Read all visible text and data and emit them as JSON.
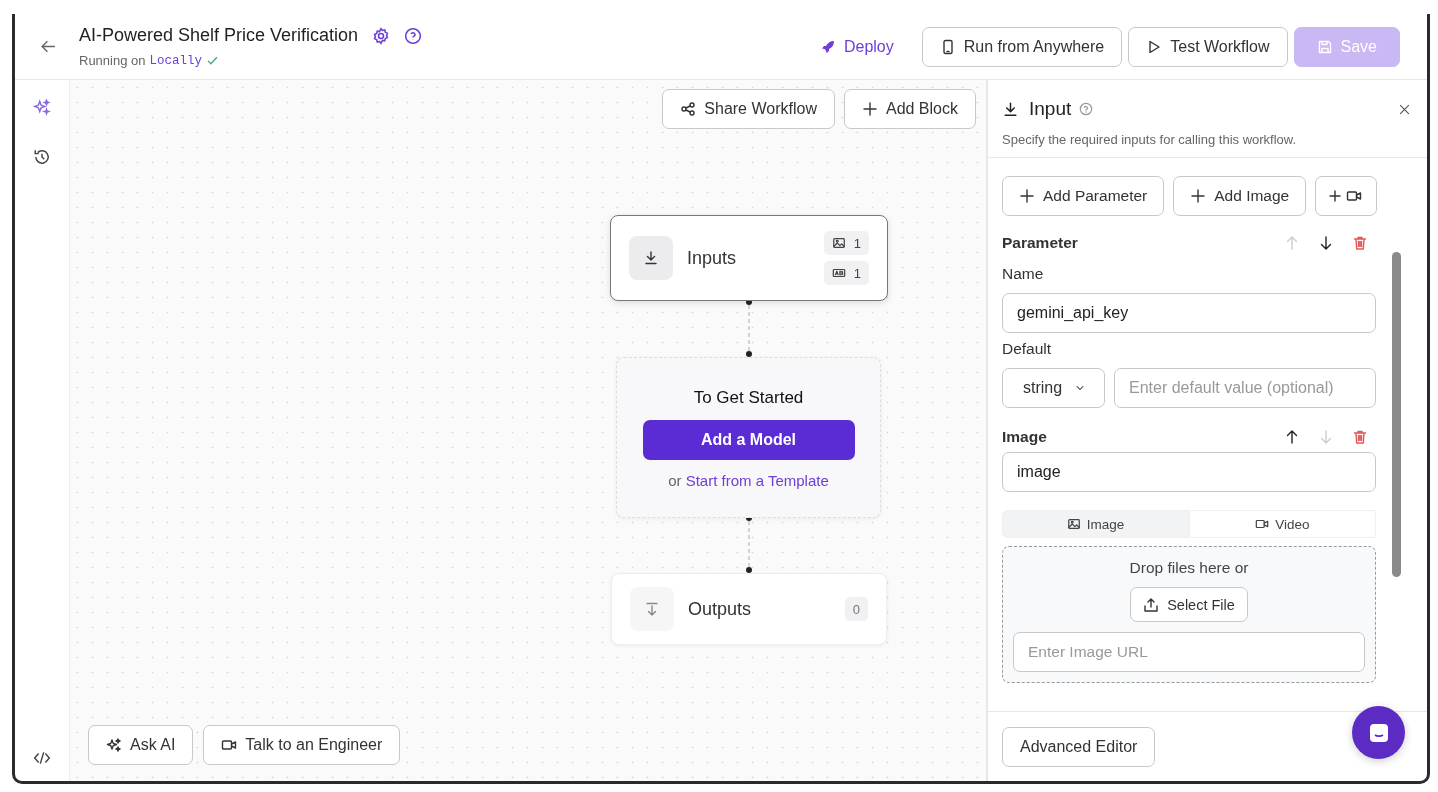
{
  "header": {
    "title": "AI-Powered Shelf Price Verification",
    "running_label": "Running on",
    "runtime": "Locally",
    "deploy": "Deploy",
    "buttons": [
      {
        "label": "Run from Anywhere",
        "kind": "phone",
        "disabled": false
      },
      {
        "label": "Test Workflow",
        "kind": "play",
        "disabled": false
      },
      {
        "label": "Save",
        "kind": "save",
        "disabled": true
      }
    ]
  },
  "canvas": {
    "toolbar": [
      {
        "label": "Share Workflow",
        "kind": "share"
      },
      {
        "label": "Add Block",
        "kind": "plus"
      }
    ],
    "inputs": {
      "title": "Inputs",
      "counts": [
        {
          "kind": "image",
          "count": "1"
        },
        {
          "kind": "text",
          "count": "1"
        }
      ]
    },
    "start": {
      "title": "To Get Started",
      "button": "Add a Model",
      "or_text": "or",
      "link": "Start from a Template"
    },
    "outputs": {
      "title": "Outputs",
      "count": "0"
    },
    "bottom_buttons": [
      {
        "label": "Ask AI",
        "kind": "sparkle"
      },
      {
        "label": "Talk to an Engineer",
        "kind": "video"
      }
    ]
  },
  "panel": {
    "title": "Input",
    "description": "Specify the required inputs for calling this workflow.",
    "add_buttons": [
      {
        "label": "Add Parameter",
        "kind": "text"
      },
      {
        "label": "Add Image",
        "kind": "text"
      },
      {
        "kind": "video"
      }
    ],
    "items": [
      {
        "kind": "parameter",
        "heading": "Parameter",
        "up_disabled": true,
        "down_disabled": false,
        "name_label": "Name",
        "name_value": "gemini_api_key",
        "default_label": "Default",
        "type": "string",
        "default_placeholder": "Enter default value (optional)"
      },
      {
        "kind": "image",
        "heading": "Image",
        "up_disabled": false,
        "down_disabled": true,
        "value": "image",
        "tabs": [
          {
            "label": "Image",
            "kind": "image",
            "selected": true
          },
          {
            "label": "Video",
            "kind": "video",
            "selected": false
          }
        ],
        "drop_text": "Drop files here or",
        "select_button": "Select File",
        "url_placeholder": "Enter Image URL"
      }
    ],
    "advanced": "Advanced Editor"
  }
}
